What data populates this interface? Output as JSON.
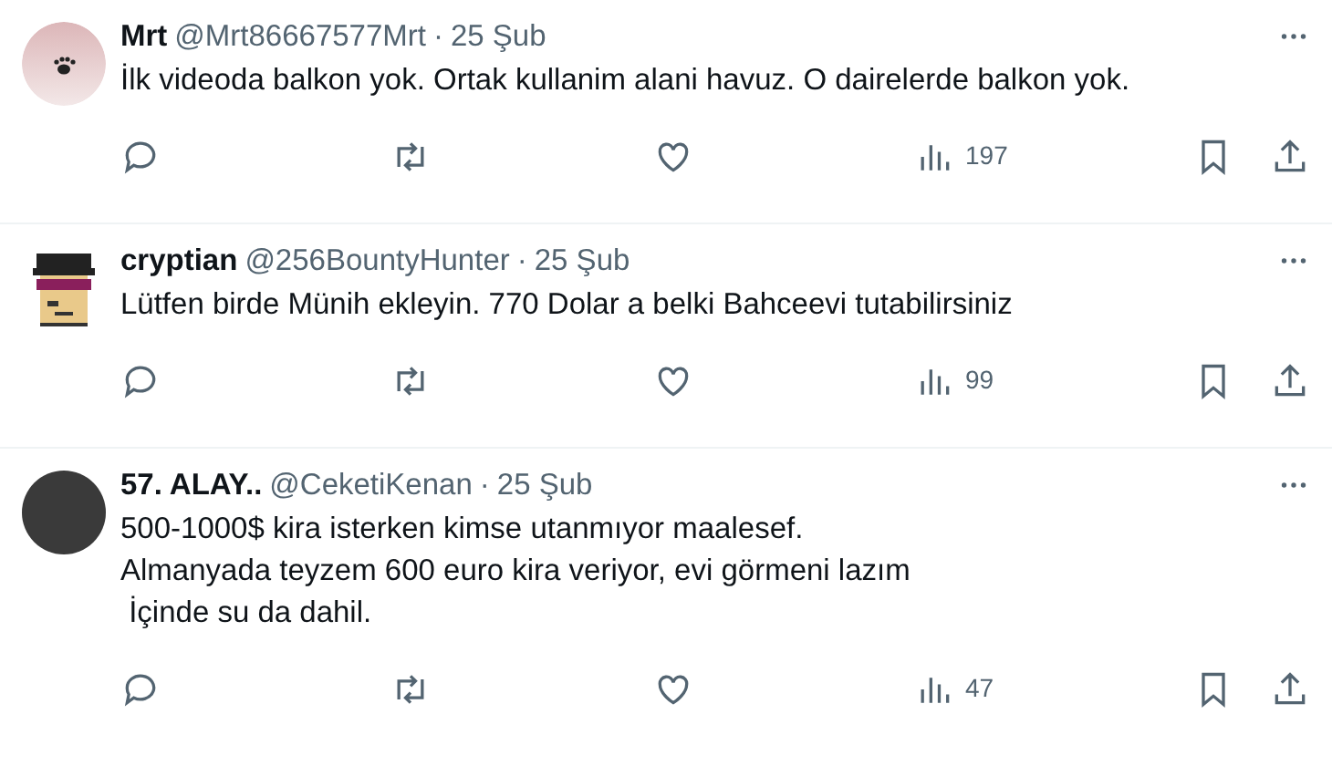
{
  "replies": [
    {
      "avatar": {
        "kind": "paw"
      },
      "name": "Mrt",
      "handle": "@Mrt86667577Mrt",
      "separator": "·",
      "date": "25 Şub",
      "text": "İlk videoda balkon yok. Ortak kullanim alani havuz. O dairelerde balkon yok.",
      "views": "197"
    },
    {
      "avatar": {
        "kind": "pixel"
      },
      "name": "cryptian",
      "handle": "@256BountyHunter",
      "separator": "·",
      "date": "25 Şub",
      "text": "Lütfen birde Münih ekleyin. 770 Dolar a belki Bahceevi tutabilirsiniz",
      "views": "99"
    },
    {
      "avatar": {
        "kind": "photo"
      },
      "name": "57. ALAY..",
      "handle": "@CeketiKenan",
      "separator": "·",
      "date": "25 Şub",
      "text": "500-1000$ kira isterken kimse utanmıyor maalesef.\nAlmanyada teyzem 600 euro kira veriyor, evi görmeni lazım\n İçinde su da dahil.",
      "views": "47"
    }
  ]
}
